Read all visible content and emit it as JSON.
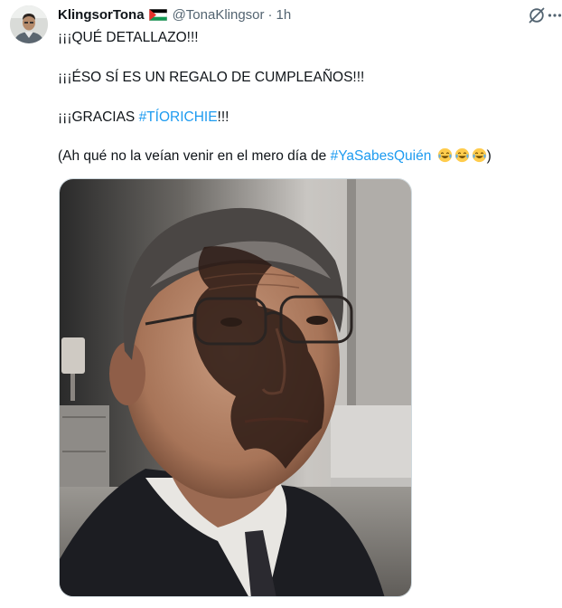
{
  "tweet": {
    "display_name": "KlingsorTona",
    "handle": "@TonaKlingsor",
    "separator": "·",
    "time": "1h",
    "line1": "¡¡¡QUÉ DETALLAZO!!!",
    "line2": "¡¡¡ÉSO SÍ ES UN REGALO DE CUMPLEAÑOS!!!",
    "line3_prefix": "¡¡¡GRACIAS ",
    "line3_hashtag": "#TÍORICHIE",
    "line3_suffix": "!!!",
    "line4_prefix": "(Ah qué no la veían venir en el mero día de ",
    "line4_hashtag": "#YaSabesQuién",
    "line4_suffix": ")",
    "emoji_name": "face-with-tears-of-joy-emoji",
    "emoji_count": 3
  },
  "colors": {
    "text": "#0f1419",
    "secondary": "#536471",
    "link": "#1d9bf0"
  },
  "icons": {
    "grok": "grok-slash-icon",
    "more": "more-dots-icon",
    "flag": "palestine-flag-icon"
  }
}
